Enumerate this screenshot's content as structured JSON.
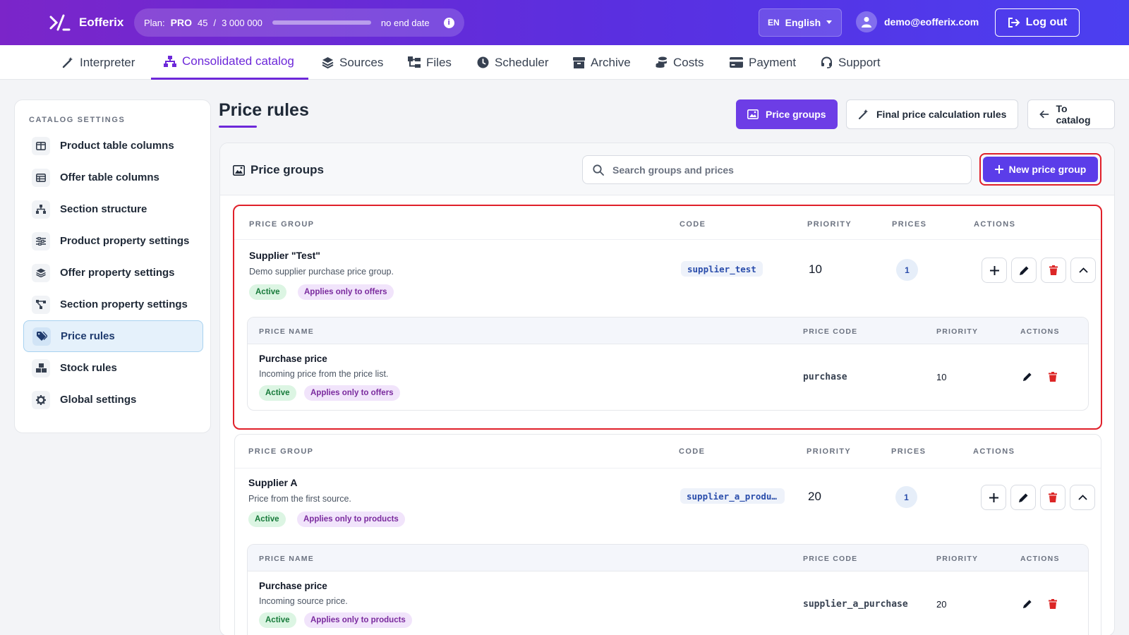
{
  "app": {
    "name": "Eofferix"
  },
  "plan": {
    "label": "Plan:",
    "name": "PRO",
    "used": "45",
    "separator": "/",
    "limit": "3 000 000",
    "usage_fraction": 1.5e-05,
    "end_text": "no end date",
    "info_glyph": "i"
  },
  "language": {
    "code": "EN",
    "name": "English"
  },
  "user": {
    "email": "demo@eofferix.com"
  },
  "logout_label": "Log out",
  "nav": [
    {
      "label": "Interpreter",
      "icon": "magic-wand-icon"
    },
    {
      "label": "Consolidated catalog",
      "icon": "sitemap-icon",
      "active": true
    },
    {
      "label": "Sources",
      "icon": "layers-icon"
    },
    {
      "label": "Files",
      "icon": "folder-tree-icon"
    },
    {
      "label": "Scheduler",
      "icon": "clock-icon"
    },
    {
      "label": "Archive",
      "icon": "archive-box-icon"
    },
    {
      "label": "Costs",
      "icon": "coins-icon"
    },
    {
      "label": "Payment",
      "icon": "credit-card-icon"
    },
    {
      "label": "Support",
      "icon": "headset-icon"
    }
  ],
  "sidebar": {
    "heading": "CATALOG SETTINGS",
    "items": [
      {
        "label": "Product table columns",
        "icon": "columns-icon"
      },
      {
        "label": "Offer table columns",
        "icon": "table-icon"
      },
      {
        "label": "Section structure",
        "icon": "sitemap-icon"
      },
      {
        "label": "Product property settings",
        "icon": "sliders-icon"
      },
      {
        "label": "Offer property settings",
        "icon": "layers-icon"
      },
      {
        "label": "Section property settings",
        "icon": "share-nodes-icon"
      },
      {
        "label": "Price rules",
        "icon": "tags-icon",
        "active": true
      },
      {
        "label": "Stock rules",
        "icon": "boxes-icon"
      },
      {
        "label": "Global settings",
        "icon": "gear-icon"
      }
    ]
  },
  "page": {
    "title": "Price rules",
    "buttons": {
      "price_groups": "Price groups",
      "final_rules": "Final price calculation rules",
      "to_catalog": "To catalog"
    }
  },
  "panel": {
    "title": "Price groups",
    "search_placeholder": "Search groups and prices",
    "new_button": "New price group",
    "headers": {
      "group": "PRICE GROUP",
      "code": "CODE",
      "priority": "PRIORITY",
      "prices": "PRICES",
      "actions": "ACTIONS"
    },
    "sub_headers": {
      "name": "PRICE NAME",
      "code": "PRICE CODE",
      "priority": "PRIORITY",
      "actions": "ACTIONS"
    },
    "groups": [
      {
        "name": "Supplier \"Test\"",
        "description": "Demo supplier purchase price group.",
        "badges": [
          "Active",
          "Applies only to offers"
        ],
        "code": "supplier_test",
        "priority": "10",
        "prices": "1",
        "price": {
          "name": "Purchase price",
          "description": "Incoming price from the price list.",
          "badges": [
            "Active",
            "Applies only to offers"
          ],
          "code": "purchase",
          "priority": "10"
        }
      },
      {
        "name": "Supplier A",
        "description": "Price from the first source.",
        "badges": [
          "Active",
          "Applies only to products"
        ],
        "code": "supplier_a_produ…",
        "priority": "20",
        "prices": "1",
        "price": {
          "name": "Purchase price",
          "description": "Incoming source price.",
          "badges": [
            "Active",
            "Applies only to products"
          ],
          "code": "supplier_a_purchase",
          "priority": "20"
        }
      }
    ]
  },
  "colors": {
    "accent": "#6d28d9",
    "primary_button": "#5b3de9",
    "highlight": "#e0202a",
    "delete": "#dc2626"
  }
}
